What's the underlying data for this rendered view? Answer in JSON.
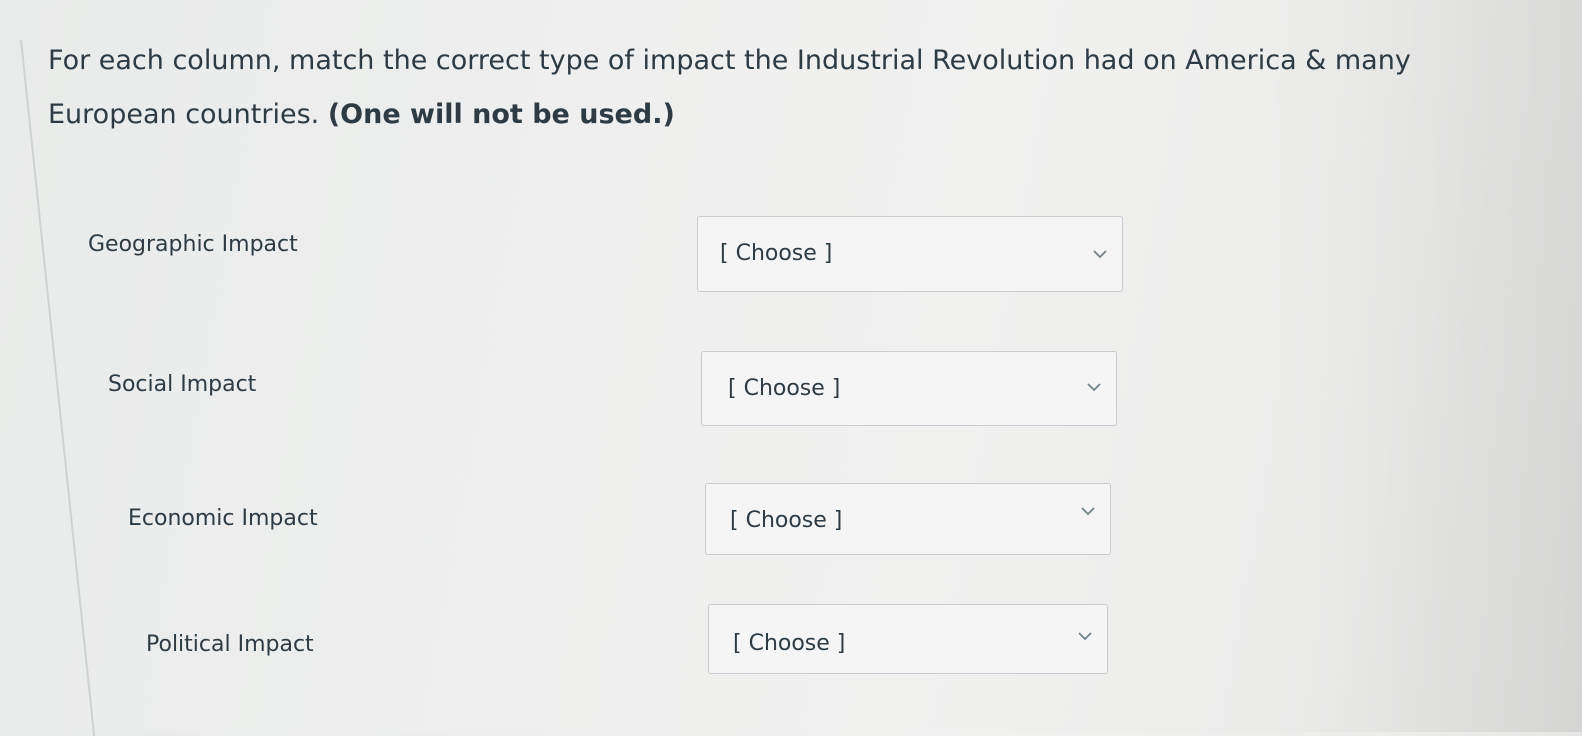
{
  "question": {
    "line1": "For each column, match the correct type of impact the Industrial Revolution had on America & many",
    "line2_prefix": "European countries. ",
    "line2_bold": "(One will not be used.)"
  },
  "rows": [
    {
      "label": "Geographic Impact",
      "select_value": "[ Choose ]"
    },
    {
      "label": "Social Impact",
      "select_value": "[ Choose ]"
    },
    {
      "label": "Economic Impact",
      "select_value": "[ Choose ]"
    },
    {
      "label": "Political Impact",
      "select_value": "[ Choose ]"
    }
  ],
  "icons": {
    "dropdown": "chevron-down-icon"
  },
  "colors": {
    "text": "#2d3b45",
    "border": "#c7cdd1"
  }
}
